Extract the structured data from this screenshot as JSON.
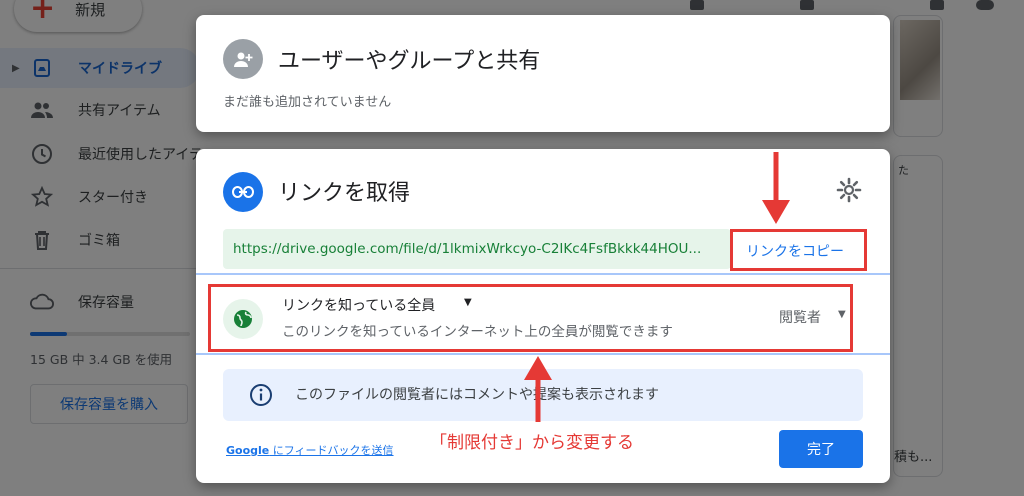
{
  "background": {
    "new_button": "新規",
    "nav_items": [
      {
        "label": "マイドライブ",
        "icon": "drive-icon",
        "active": true
      },
      {
        "label": "共有アイテム",
        "icon": "people-icon",
        "active": false
      },
      {
        "label": "最近使用したアイテ",
        "icon": "clock-icon",
        "active": false
      },
      {
        "label": "スター付き",
        "icon": "star-icon",
        "active": false
      },
      {
        "label": "ゴミ箱",
        "icon": "trash-icon",
        "active": false
      }
    ],
    "storage_label": "保存容量",
    "storage_fraction": 0.23,
    "storage_usage": "15 GB 中 3.4 GB を使用",
    "buy_storage_button": "保存容量を購入",
    "right_snippets": [
      "た",
      "積も..."
    ]
  },
  "share_dialog": {
    "title": "ユーザーやグループと共有",
    "subtitle": "まだ誰も追加されていません",
    "icon": "person-add-icon"
  },
  "link_dialog": {
    "title": "リンクを取得",
    "icon": "link-icon",
    "settings_icon": "gear-icon",
    "url": "https://drive.google.com/file/d/1lkmixWrkcyo-C2IKc4FsfBkkk44HOU...",
    "copy_link": "リンクをコピー",
    "access": {
      "title": "リンクを知っている全員",
      "description": "このリンクを知っているインターネット上の全員が閲覧できます",
      "role": "閲覧者",
      "icon": "globe-icon"
    },
    "info": {
      "icon": "info-icon",
      "text": "このファイルの閲覧者にはコメントや提案も表示されます"
    },
    "feedback_brand": "Google",
    "feedback_text": " にフィードバックを送信",
    "done_button": "完了"
  },
  "annotation": {
    "text": "「制限付き」から変更する",
    "color": "#e53935"
  },
  "colors": {
    "accent": "#1a73e8",
    "url_green": "#188038",
    "url_bg": "#e6f4ea",
    "annotation_red": "#e53935"
  }
}
